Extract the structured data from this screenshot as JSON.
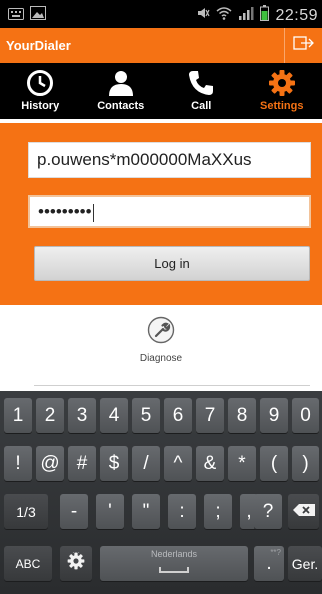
{
  "status_bar": {
    "time": "22:59"
  },
  "app": {
    "title": "YourDialer"
  },
  "tabs": [
    {
      "label": "History",
      "icon": "clock-icon"
    },
    {
      "label": "Contacts",
      "icon": "person-icon"
    },
    {
      "label": "Call",
      "icon": "phone-icon"
    },
    {
      "label": "Settings",
      "icon": "gear-icon",
      "active": true
    }
  ],
  "login": {
    "username_value": "p.ouwens*m000000MaXXus",
    "password_value": "•••••••••",
    "login_label": "Log in"
  },
  "diagnose": {
    "label": "Diagnose",
    "icon": "wrench-icon"
  },
  "keyboard": {
    "row1": [
      "1",
      "2",
      "3",
      "4",
      "5",
      "6",
      "7",
      "8",
      "9",
      "0"
    ],
    "row2": [
      "!",
      "@",
      "#",
      "$",
      "/",
      "^",
      "&",
      "*",
      "(",
      ")"
    ],
    "row3": [
      "1/3",
      "-",
      "'",
      "\"",
      ":",
      ";",
      ",",
      "?"
    ],
    "row4": {
      "abc": "ABC",
      "space_label": "Nederlands",
      "next_sub": "**?",
      "next_key": ".",
      "go": "Ger."
    }
  },
  "colors": {
    "accent": "#f57214",
    "tab_bar": "#000000",
    "status_bar": "#000000"
  }
}
